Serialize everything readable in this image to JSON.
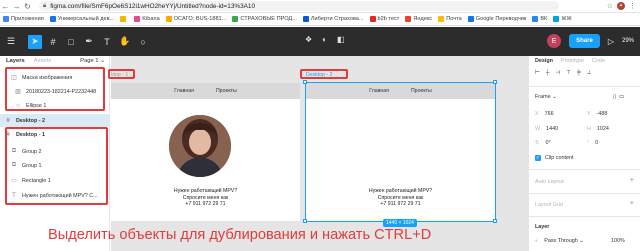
{
  "browser": {
    "url": "figma.com/file/SmF6pOe6S12i1wHO2heYYj/Untitled?node-id=13%3A10",
    "bookmarks": [
      {
        "label": "Приложения",
        "color": "#4285f4"
      },
      {
        "label": "Универсальный дев...",
        "color": "#1a73e8"
      },
      {
        "label": "",
        "color": "#f4b400"
      },
      {
        "label": "Kibana",
        "color": "#e8478b"
      },
      {
        "label": "ОСАГО: BUS-1881...",
        "color": "#f9ab00"
      },
      {
        "label": "СТРАХОВЫЕ ПРОД...",
        "color": "#34a853"
      },
      {
        "label": "Либерти Страхова...",
        "color": "#0b57d0"
      },
      {
        "label": "b2b тест",
        "color": "#d93025"
      },
      {
        "label": "Яндекс",
        "color": "#ea4335"
      },
      {
        "label": "Почта",
        "color": "#fbbc04"
      },
      {
        "label": "Google Переводчик",
        "color": "#1a73e8"
      },
      {
        "label": "ВК",
        "color": "#2787f5"
      },
      {
        "label": "ЖЖ",
        "color": "#00a0e9"
      }
    ]
  },
  "toolbar": {
    "avatar_letter": "E",
    "share_label": "Share",
    "zoom": "29%"
  },
  "left_panel": {
    "tab_layers": "Layers",
    "tab_assets": "Assets",
    "page": "Page 1 ⌄",
    "layers": [
      {
        "label": "Маска изображения",
        "icon": "◫"
      },
      {
        "label": "20180223-182214-P2232448",
        "icon": "▨"
      },
      {
        "label": "Ellipse 1",
        "icon": "○"
      },
      {
        "label": "Desktop - 2",
        "icon": "#"
      },
      {
        "label": "Desktop - 1",
        "icon": "#"
      },
      {
        "label": "Group 2",
        "icon": "⧉"
      },
      {
        "label": "Group 1",
        "icon": "⧉"
      },
      {
        "label": "Rectangle 1",
        "icon": "▭"
      },
      {
        "label": "Нужен работающий MPV? С...",
        "icon": "T"
      }
    ]
  },
  "canvas": {
    "frames": [
      {
        "label": "ktop - 1",
        "nav_main": "Главная",
        "nav_projects": "Проекты",
        "cta_line1": "Нужен работающий MPV?",
        "cta_line2": "Спросите меня как",
        "cta_line3": "+7 911 972 29 71"
      },
      {
        "label": "Desktop - 2",
        "nav_main": "Главная",
        "nav_projects": "Проекты",
        "cta_line1": "Нужен работающий MPV?",
        "cta_line2": "Спросите меня как",
        "cta_line3": "+7 911 972 29 71",
        "size_badge": "1440 × 1024"
      }
    ]
  },
  "right_panel": {
    "tab_design": "Design",
    "tab_prototype": "Prototype",
    "tab_code": "Code",
    "frame_label": "Frame ⌄",
    "x_label": "X",
    "x_value": "766",
    "y_label": "Y",
    "y_value": "-488",
    "w_label": "W",
    "w_value": "1440",
    "h_label": "H",
    "h_value": "1024",
    "rotation": "0°",
    "radius": "0",
    "clip_content": "Clip content",
    "auto_layout": "Auto Layout",
    "layout_grid": "Layout Grid",
    "layer_title": "Layer",
    "blend_mode": "Pass Through ⌄",
    "opacity": "100%"
  },
  "annotation": {
    "caption": "Выделить объекты для дублирования и нажать CTRL+D",
    "accent": "#e43a3a"
  }
}
